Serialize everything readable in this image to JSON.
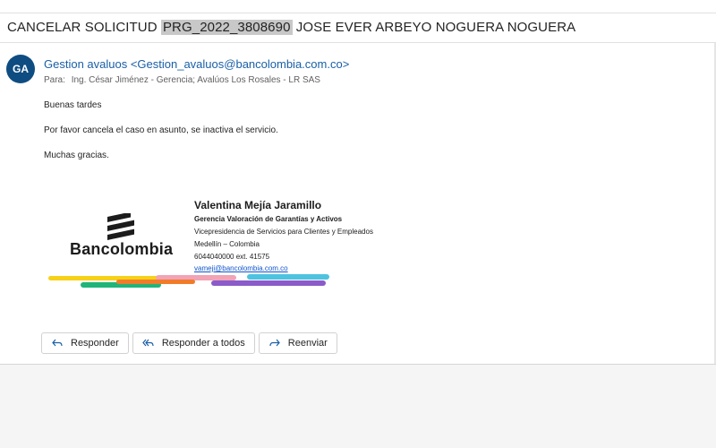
{
  "subject": {
    "prefix": "CANCELAR SOLICITUD",
    "highlight": "PRG_2022_3808690",
    "suffix": "JOSE EVER ARBEYO NOGUERA NOGUERA"
  },
  "message": {
    "avatar_initials": "GA",
    "avatar_color": "#0f4c81",
    "sender": "Gestion avaluos <Gestion_avaluos@bancolombia.com.co>",
    "to_label": "Para:",
    "recipients": "Ing. César Jiménez - Gerencia;  Avalúos Los Rosales - LR SAS",
    "body": [
      "Buenas tardes",
      "Por favor cancela el caso en asunto, se inactiva el servicio.",
      "Muchas gracias."
    ]
  },
  "signature": {
    "logo_text": "Bancolombia",
    "name": "Valentina Mejía Jaramillo",
    "title": "Gerencia Valoración de Garantías y Activos",
    "department": "Vicepresidencia de Servicios para Clientes y Empleados",
    "location": "Medellín – Colombia",
    "phone": "6044040000 ext. 41575",
    "email": "vameji@bancolombia.com.co"
  },
  "actions": {
    "reply": "Responder",
    "reply_all": "Responder a todos",
    "forward": "Reenviar"
  },
  "colors": {
    "link": "#1a5fa8",
    "stripe_yellow": "#f7d117",
    "stripe_green": "#1fb57a",
    "stripe_orange": "#f07c2b",
    "stripe_pink": "#f2a3b5",
    "stripe_cyan": "#4ec3e0",
    "stripe_purple": "#8a5bc9"
  }
}
